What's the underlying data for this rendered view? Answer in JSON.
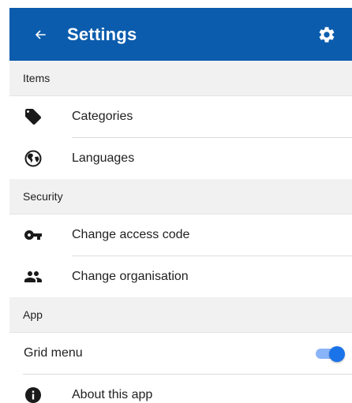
{
  "app_bar": {
    "title": "Settings",
    "back_icon": "arrow-left-icon",
    "settings_icon": "gear-icon",
    "background_color": "#0b5cad"
  },
  "sections": {
    "items": {
      "header": "Items",
      "entries": [
        {
          "label": "Categories",
          "icon": "tag-icon"
        },
        {
          "label": "Languages",
          "icon": "globe-icon"
        }
      ]
    },
    "security": {
      "header": "Security",
      "entries": [
        {
          "label": "Change access code",
          "icon": "key-icon"
        },
        {
          "label": "Change organisation",
          "icon": "people-icon"
        }
      ]
    },
    "app": {
      "header": "App",
      "grid_menu": {
        "label": "Grid menu",
        "toggle_on": true,
        "accent_color": "#1a73e8"
      },
      "entries": [
        {
          "label": "About this app",
          "icon": "info-icon"
        }
      ]
    }
  }
}
